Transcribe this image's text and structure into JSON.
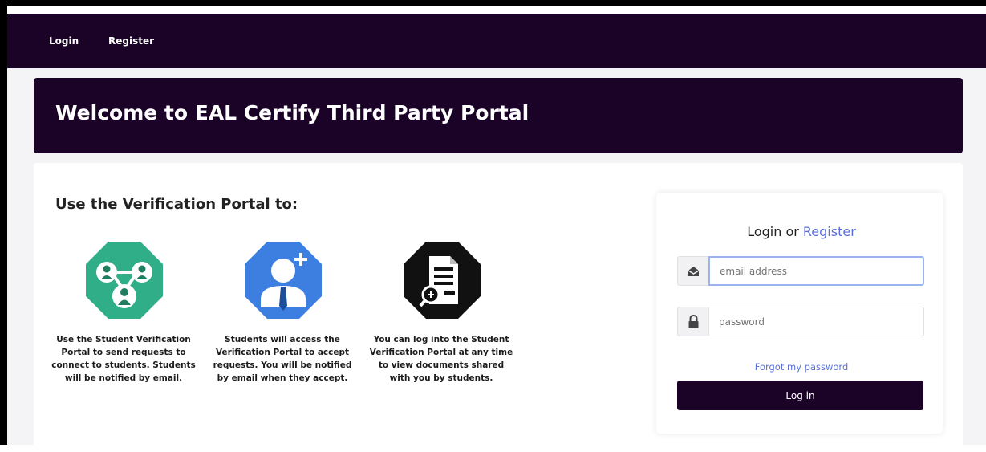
{
  "nav": {
    "login": "Login",
    "register": "Register"
  },
  "banner": {
    "title": "Welcome to EAL Certify Third Party Portal"
  },
  "section": {
    "title": "Use the Verification Portal to:"
  },
  "features": [
    {
      "icon": "connect-students-icon",
      "color": "#2fae87",
      "text": "Use the Student Verification Portal to send requests to connect to students. Students will be notified by email."
    },
    {
      "icon": "add-user-icon",
      "color": "#3d7fe0",
      "text": "Students will access the Verification Portal to accept requests. You will be notified by email when they accept."
    },
    {
      "icon": "document-search-icon",
      "color": "#111111",
      "text": "You can log into the Student Verification Portal at any time to view documents shared with you by students."
    }
  ],
  "login": {
    "title_prefix": "Login or ",
    "title_link": "Register",
    "email_placeholder": "email address",
    "password_placeholder": "password",
    "forgot": "Forgot my password",
    "button": "Log in"
  },
  "colors": {
    "brand_dark": "#1a0326",
    "link": "#5b6fd8"
  }
}
